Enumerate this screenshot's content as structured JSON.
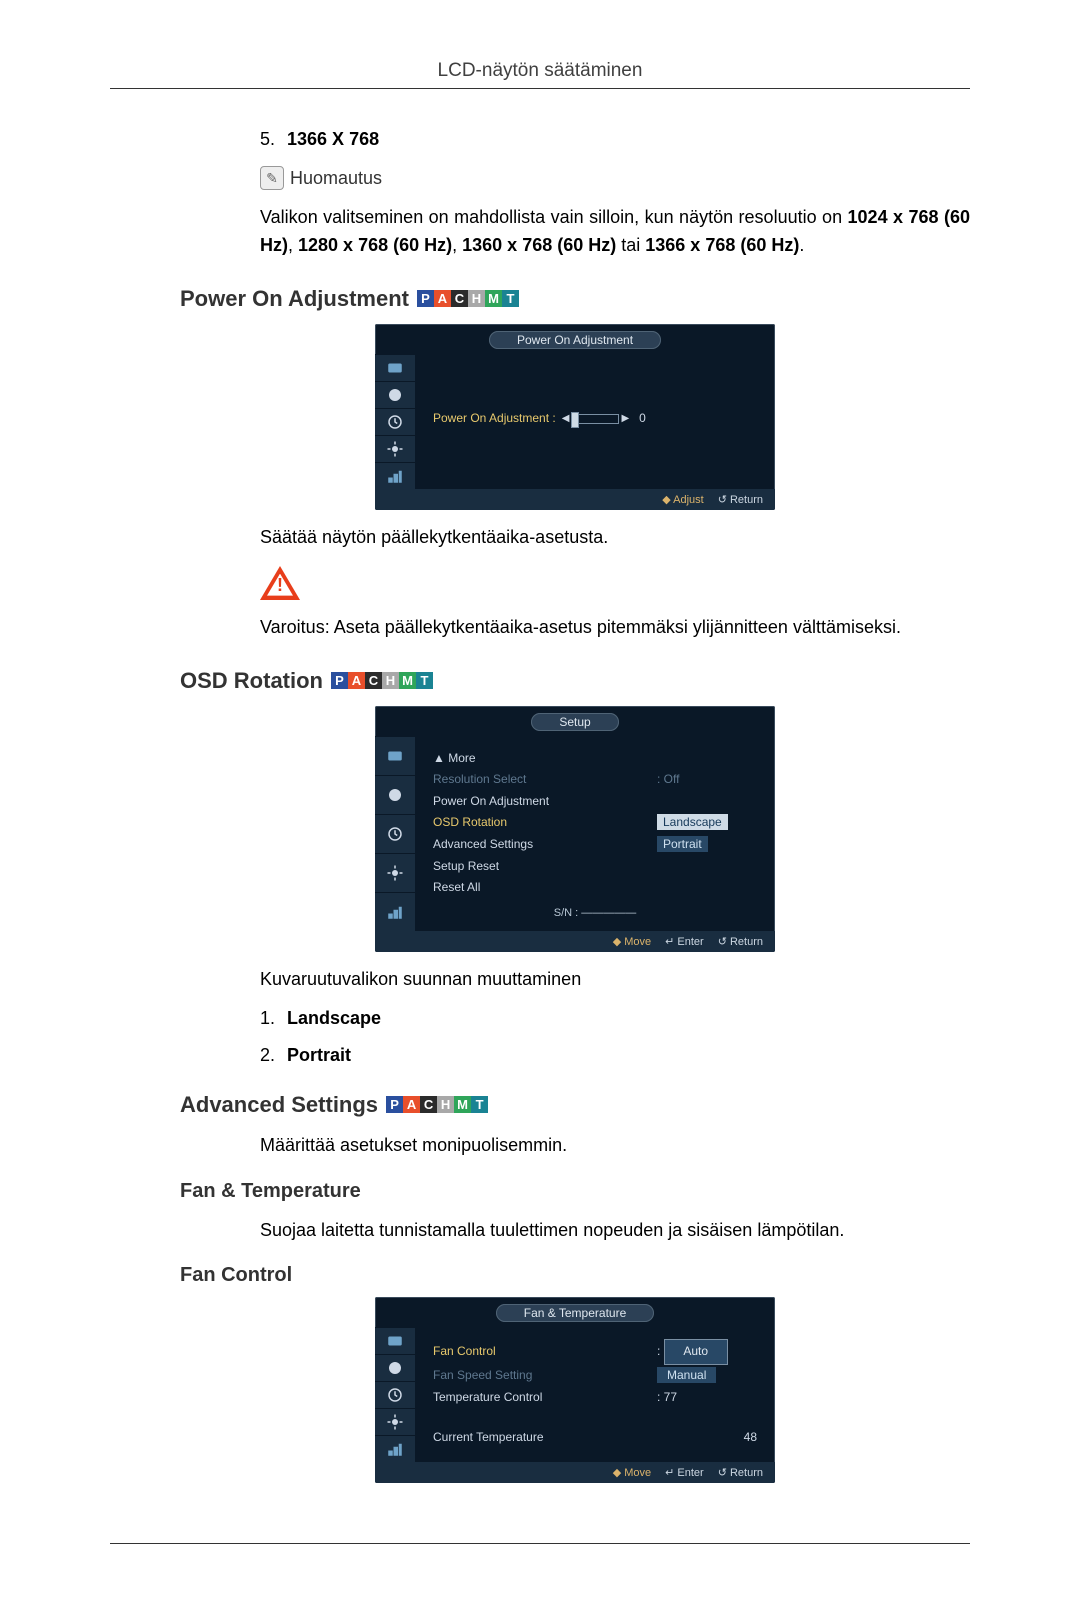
{
  "header_title": "LCD-näytön säätäminen",
  "item5": {
    "num": "5.",
    "label": "1366 X 768"
  },
  "note_label": "Huomautus",
  "note_para_a": "Valikon valitseminen on mahdollista vain silloin, kun näytön resoluutio on ",
  "note_para_b": "1024 x 768 (60 Hz)",
  "note_para_c": ", ",
  "note_para_d": "1280 x 768 (60 Hz)",
  "note_para_e": ", ",
  "note_para_f": "1360 x 768 (60 Hz)",
  "note_para_g": " tai ",
  "note_para_h": "1366 x 768 (60 Hz)",
  "note_para_i": ".",
  "h_power": "Power On Adjustment",
  "osd1": {
    "title": "Power On Adjustment",
    "label": "Power On Adjustment :",
    "value": "0",
    "foot_adjust": "◆ Adjust",
    "foot_return": "↺ Return"
  },
  "power_desc": "Säätää näytön päällekytkentäaika-asetusta.",
  "power_warn": "Varoitus: Aseta päällekytkentäaika-asetus pitemmäksi ylijännitteen välttämiseksi.",
  "h_osd_rot": "OSD Rotation",
  "osd2": {
    "title": "Setup",
    "more": "▲ More",
    "items": {
      "res_sel": "Resolution Select",
      "res_val": ": Off",
      "poa": "Power On Adjustment",
      "osd_rot": "OSD Rotation",
      "osd_val1": "Landscape",
      "osd_val2": "Portrait",
      "adv": "Advanced Settings",
      "sreset": "Setup Reset",
      "rall": "Reset All"
    },
    "sn": "S/N : —————",
    "foot_move": "◆ Move",
    "foot_enter": "↵ Enter",
    "foot_return": "↺ Return"
  },
  "rot_desc": "Kuvaruutuvalikon suunnan muuttaminen",
  "rot_list": {
    "n1": "1.",
    "v1": "Landscape",
    "n2": "2.",
    "v2": "Portrait"
  },
  "h_adv": "Advanced Settings",
  "adv_desc": "Määrittää asetukset monipuolisemmin.",
  "h_fantemp": "Fan & Temperature",
  "fantemp_desc": "Suojaa laitetta tunnistamalla tuulettimen nopeuden ja sisäisen lämpötilan.",
  "h_fanctrl": "Fan Control",
  "osd3": {
    "title": "Fan & Temperature",
    "fc": "Fan Control",
    "fc_v1": "Auto",
    "fc_v2": "Manual",
    "fss": "Fan Speed Setting",
    "tc": "Temperature Control",
    "tc_v": ": 77",
    "cur": "Current Temperature",
    "cur_v": "48",
    "foot_move": "◆ Move",
    "foot_enter": "↵ Enter",
    "foot_return": "↺ Return"
  }
}
